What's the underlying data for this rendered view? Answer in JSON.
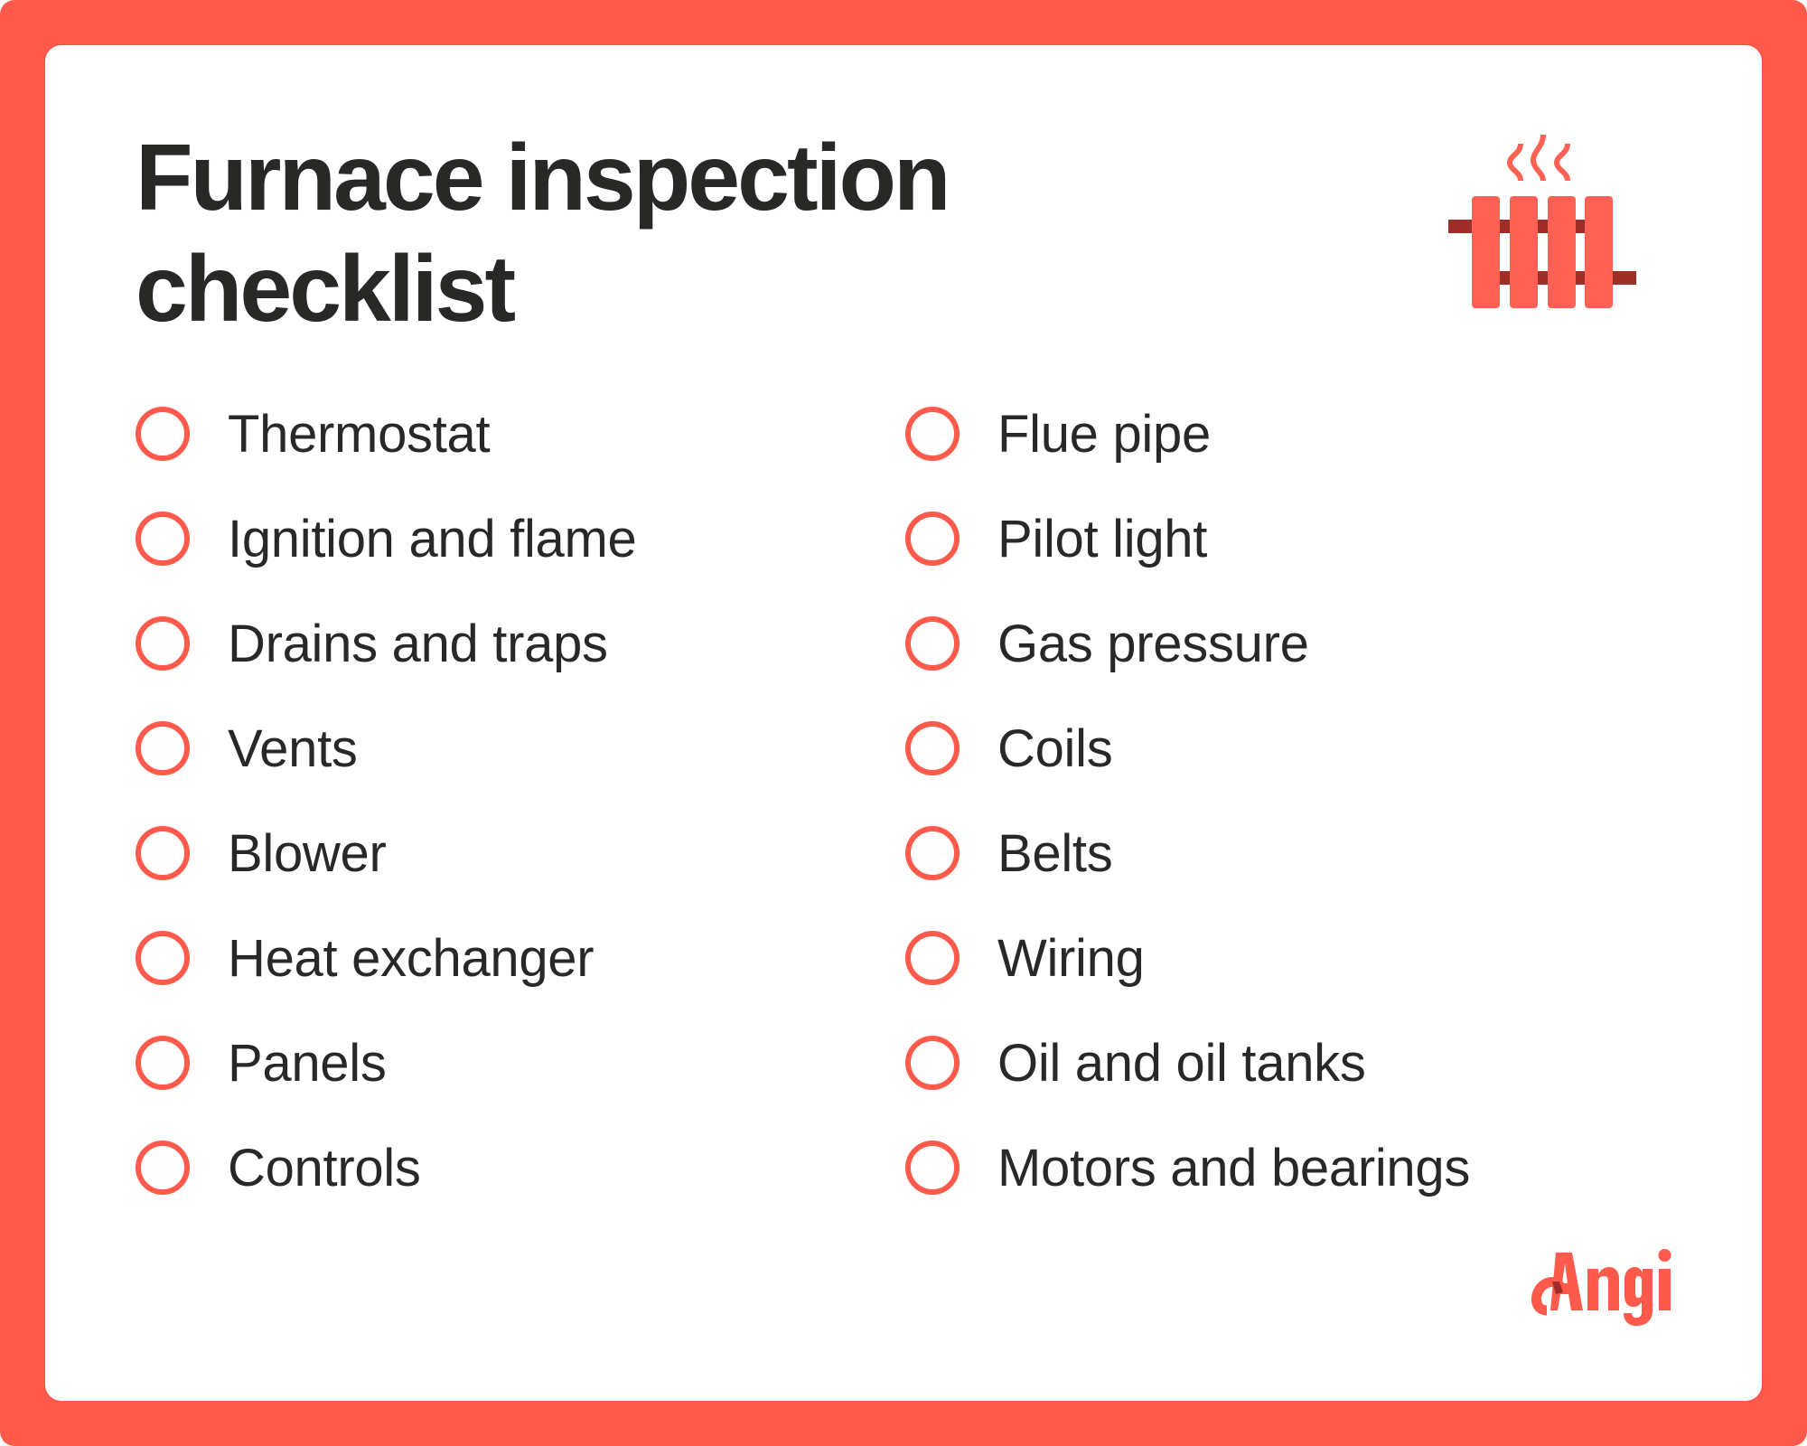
{
  "title": {
    "line1": "Furnace inspection",
    "line2": "checklist"
  },
  "header_icon": "radiator-heat-icon",
  "checklist": {
    "left_column": [
      {
        "label": "Thermostat",
        "checked": false
      },
      {
        "label": "Ignition and flame",
        "checked": false
      },
      {
        "label": "Drains and traps",
        "checked": false
      },
      {
        "label": "Vents",
        "checked": false
      },
      {
        "label": "Blower",
        "checked": false
      },
      {
        "label": "Heat exchanger",
        "checked": false
      },
      {
        "label": "Panels",
        "checked": false
      },
      {
        "label": "Controls",
        "checked": false
      }
    ],
    "right_column": [
      {
        "label": "Flue pipe",
        "checked": false
      },
      {
        "label": "Pilot light",
        "checked": false
      },
      {
        "label": "Gas pressure",
        "checked": false
      },
      {
        "label": "Coils",
        "checked": false
      },
      {
        "label": "Belts",
        "checked": false
      },
      {
        "label": "Wiring",
        "checked": false
      },
      {
        "label": "Oil and oil tanks",
        "checked": false
      },
      {
        "label": "Motors and bearings",
        "checked": false
      }
    ]
  },
  "brand": {
    "name": "Angi"
  },
  "colors": {
    "accent": "#FF5A4B",
    "icon_light": "#FF6154",
    "icon_dark": "#A02E28",
    "text": "#282826",
    "background": "#FFFFFF"
  }
}
